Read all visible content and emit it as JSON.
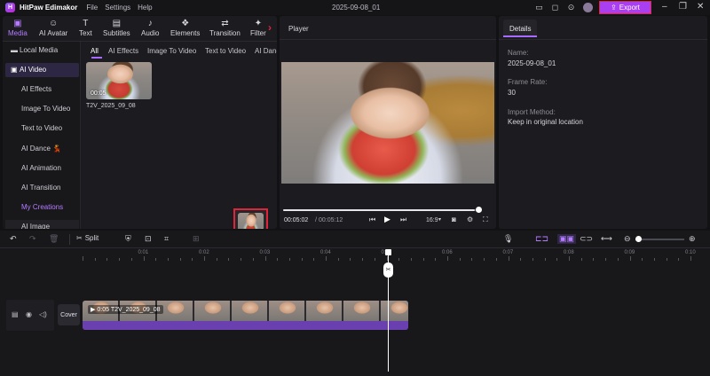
{
  "app": {
    "logo_letter": "H",
    "name": "HitPaw Edimakor",
    "menus": [
      "File",
      "Settings",
      "Help"
    ],
    "project_date": "2025-09-08_01",
    "export_label": "Export"
  },
  "toolbar": {
    "items": [
      {
        "icon": "media-icon",
        "glyph": "▣",
        "label": "Media"
      },
      {
        "icon": "ai-avatar-icon",
        "glyph": "☺",
        "label": "AI Avatar"
      },
      {
        "icon": "text-icon",
        "glyph": "T",
        "label": "Text"
      },
      {
        "icon": "subtitles-icon",
        "glyph": "▤",
        "label": "Subtitles"
      },
      {
        "icon": "audio-icon",
        "glyph": "♪",
        "label": "Audio"
      },
      {
        "icon": "elements-icon",
        "glyph": "❖",
        "label": "Elements"
      },
      {
        "icon": "transition-icon",
        "glyph": "⇄",
        "label": "Transition"
      },
      {
        "icon": "filter-icon",
        "glyph": "✦",
        "label": "Filter"
      }
    ]
  },
  "sidebar": {
    "items": [
      {
        "label": "Local Media",
        "icon": "folder-icon",
        "glyph": "▬"
      },
      {
        "label": "AI Video",
        "icon": "ai-video-icon",
        "glyph": "▣"
      },
      {
        "label": "AI Effects"
      },
      {
        "label": "Image To Video"
      },
      {
        "label": "Text to Video"
      },
      {
        "label": "AI Dance 💃"
      },
      {
        "label": "AI Animation"
      },
      {
        "label": "AI Transition"
      },
      {
        "label": "My Creations"
      },
      {
        "label": "AI Image"
      }
    ]
  },
  "subtabs": [
    "All",
    "AI Effects",
    "Image To Video",
    "Text to Video",
    "AI Dance"
  ],
  "media": {
    "clip_duration": "00:05",
    "clip_name": "T2V_2025_09_08"
  },
  "player": {
    "title": "Player",
    "current_time": "00:05:02",
    "total_time": "00:05:12",
    "aspect": "16:9",
    "progress": 0.98
  },
  "details": {
    "tab": "Details",
    "name_label": "Name:",
    "name_value": "2025-09-08_01",
    "fps_label": "Frame Rate:",
    "fps_value": "30",
    "import_label": "Import Method:",
    "import_value": "Keep in original location"
  },
  "timeline": {
    "split_label": "Split",
    "ruler": [
      "0:01",
      "0:02",
      "0:03",
      "0:04",
      "0:05",
      "0:06",
      "0:07",
      "0:08",
      "0:09",
      "0:10"
    ],
    "cover_label": "Cover",
    "clip_label": "0:05 T2V_2025_09_08"
  }
}
